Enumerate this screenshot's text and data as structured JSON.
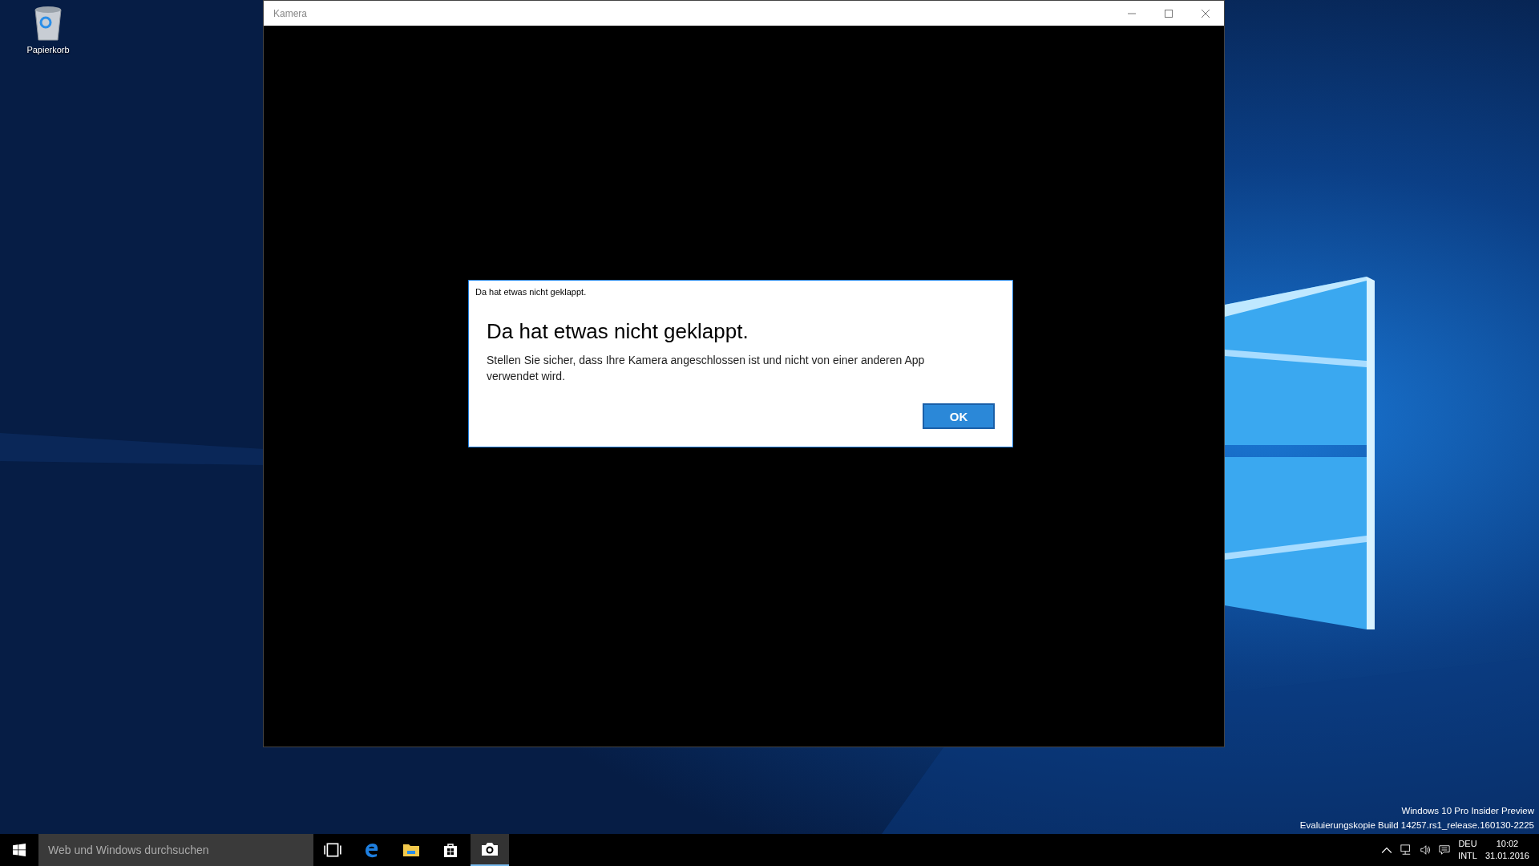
{
  "desktop": {
    "icons": [
      {
        "label": "Papierkorb"
      }
    ],
    "watermark_lines": [
      "Windows 10 Pro Insider Preview",
      "Evaluierungskopie Build 14257.rs1_release.160130-2225"
    ]
  },
  "window": {
    "title": "Kamera",
    "controls": [
      {
        "kind": "minimize"
      },
      {
        "kind": "maximize"
      },
      {
        "kind": "close"
      }
    ]
  },
  "dialog": {
    "caption": "Da hat etwas nicht geklappt.",
    "heading": "Da hat etwas nicht geklappt.",
    "message": "Stellen Sie sicher, dass Ihre Kamera angeschlossen ist und nicht von einer anderen App verwendet wird.",
    "buttons": [
      "OK"
    ]
  },
  "taskbar": {
    "search": {
      "placeholder": "Web und Windows durchsuchen"
    },
    "apps": [
      {
        "kind": "taskview",
        "selected": false
      },
      {
        "kind": "edge",
        "selected": false
      },
      {
        "kind": "explorer",
        "selected": false
      },
      {
        "kind": "store",
        "selected": false
      },
      {
        "kind": "camera",
        "selected": true
      }
    ],
    "tray": {
      "language": [
        "DEU",
        "INTL"
      ],
      "time": "10:02",
      "date": "31.01.2016"
    }
  }
}
